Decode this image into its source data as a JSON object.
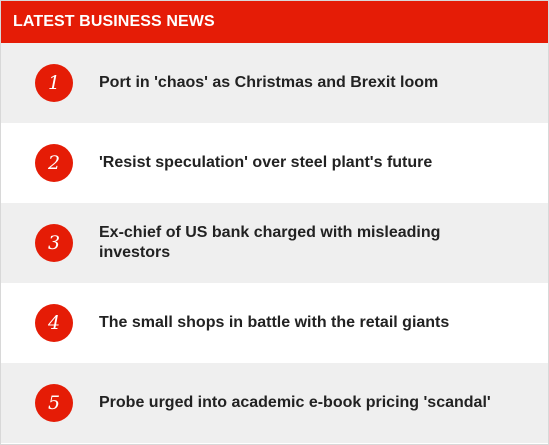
{
  "header": {
    "title": "LATEST BUSINESS NEWS"
  },
  "accent_color": "#e51c06",
  "items": [
    {
      "rank": "1",
      "headline": "Port in 'chaos' as Christmas and Brexit loom"
    },
    {
      "rank": "2",
      "headline": "'Resist speculation' over steel plant's future"
    },
    {
      "rank": "3",
      "headline": "Ex-chief of US bank charged with misleading investors"
    },
    {
      "rank": "4",
      "headline": "The small shops in battle with the retail giants"
    },
    {
      "rank": "5",
      "headline": "Probe urged into academic e-book pricing 'scandal'"
    }
  ]
}
